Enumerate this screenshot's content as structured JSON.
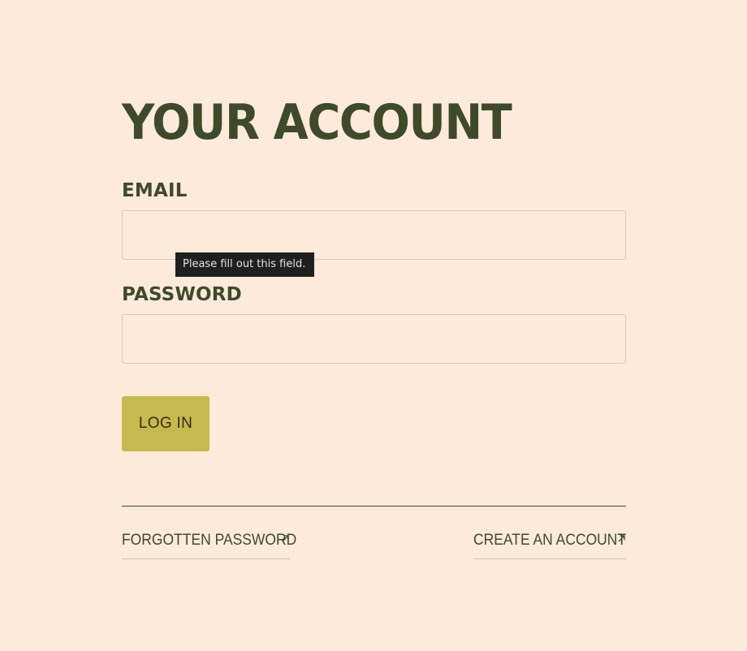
{
  "page": {
    "title": "YOUR ACCOUNT"
  },
  "form": {
    "email_label": "EMAIL",
    "email_value": "",
    "password_label": "PASSWORD",
    "password_value": "",
    "validation_tooltip": "Please fill out this field.",
    "login_label": "LOG IN"
  },
  "links": {
    "forgotten_password": "FORGOTTEN PASSWORD",
    "create_account": "CREATE AN ACCOUNT",
    "icon": "external-arrow-icon"
  },
  "colors": {
    "background": "#fdeadb",
    "heading": "#3e4a29",
    "button": "#c6b950",
    "tooltip_bg": "#1f1f1f"
  }
}
